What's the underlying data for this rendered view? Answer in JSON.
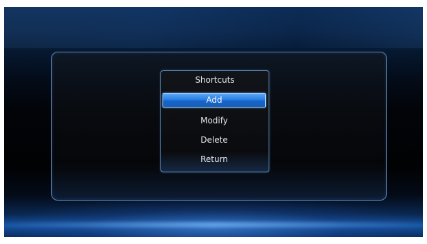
{
  "dialog": {
    "title": "Shortcuts",
    "items": [
      {
        "label": "Add",
        "selected": true
      },
      {
        "label": "Modify",
        "selected": false
      },
      {
        "label": "Delete",
        "selected": false
      },
      {
        "label": "Return",
        "selected": false
      }
    ]
  },
  "colors": {
    "selection": "#2a7fe0",
    "border": "#5f8dbd",
    "text": "#e6e6e6"
  }
}
